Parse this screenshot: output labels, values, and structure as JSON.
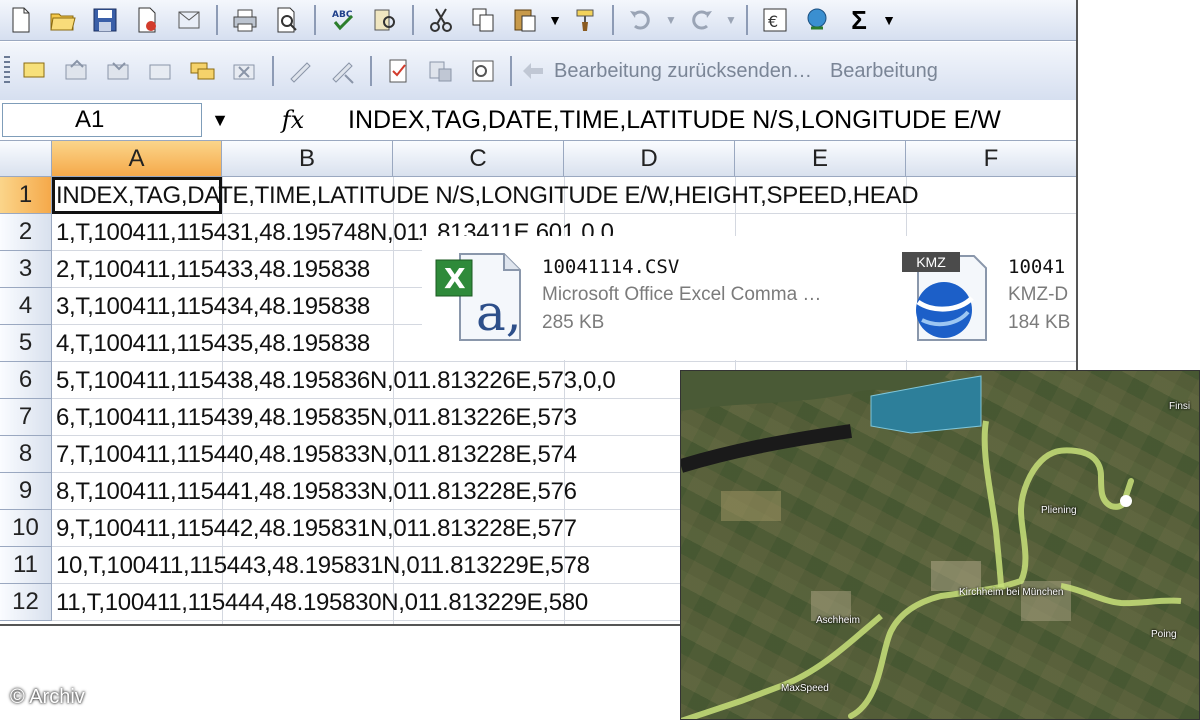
{
  "toolbar2": {
    "send_back_label": "Bearbeitung zurücksenden…",
    "end_review_label": "Bearbeitung"
  },
  "formula_bar": {
    "name_box": "A1",
    "fx_label": "fx",
    "formula": "INDEX,TAG,DATE,TIME,LATITUDE N/S,LONGITUDE E/W"
  },
  "columns": [
    "A",
    "B",
    "C",
    "D",
    "E",
    "F"
  ],
  "rows": [
    {
      "num": "1",
      "text": "INDEX,TAG,DATE,TIME,LATITUDE N/S,LONGITUDE E/W,HEIGHT,SPEED,HEAD"
    },
    {
      "num": "2",
      "text": "1,T,100411,115431,48.195748N,011.813411E,601,0,0"
    },
    {
      "num": "3",
      "text": "2,T,100411,115433,48.195838"
    },
    {
      "num": "4",
      "text": "3,T,100411,115434,48.195838"
    },
    {
      "num": "5",
      "text": "4,T,100411,115435,48.195838"
    },
    {
      "num": "6",
      "text": "5,T,100411,115438,48.195836N,011.813226E,573,0,0"
    },
    {
      "num": "7",
      "text": "6,T,100411,115439,48.195835N,011.813226E,573"
    },
    {
      "num": "8",
      "text": "7,T,100411,115440,48.195833N,011.813228E,574"
    },
    {
      "num": "9",
      "text": "8,T,100411,115441,48.195833N,011.813228E,576"
    },
    {
      "num": "10",
      "text": "9,T,100411,115442,48.195831N,011.813228E,577"
    },
    {
      "num": "11",
      "text": "10,T,100411,115443,48.195831N,011.813229E,578"
    },
    {
      "num": "12",
      "text": "11,T,100411,115444,48.195830N,011.813229E,580"
    }
  ],
  "files": [
    {
      "name": "10041114.CSV",
      "type": "Microsoft Office Excel Comma …",
      "size": "285 KB"
    },
    {
      "name": "10041",
      "type": "KMZ-D",
      "size": "184 KB",
      "badge": "KMZ"
    }
  ],
  "map_labels": {
    "pliening": "Pliening",
    "kirchheim": "Kirchheim bei München",
    "aschheim": "Aschheim",
    "poing": "Poing",
    "finsing": "Finsi",
    "maxspeed": "MaxSpeed"
  },
  "credit": "© Archiv",
  "colors": {
    "accent": "#f5a94a",
    "route": "#c8e07a",
    "water": "#2d7f9a"
  }
}
